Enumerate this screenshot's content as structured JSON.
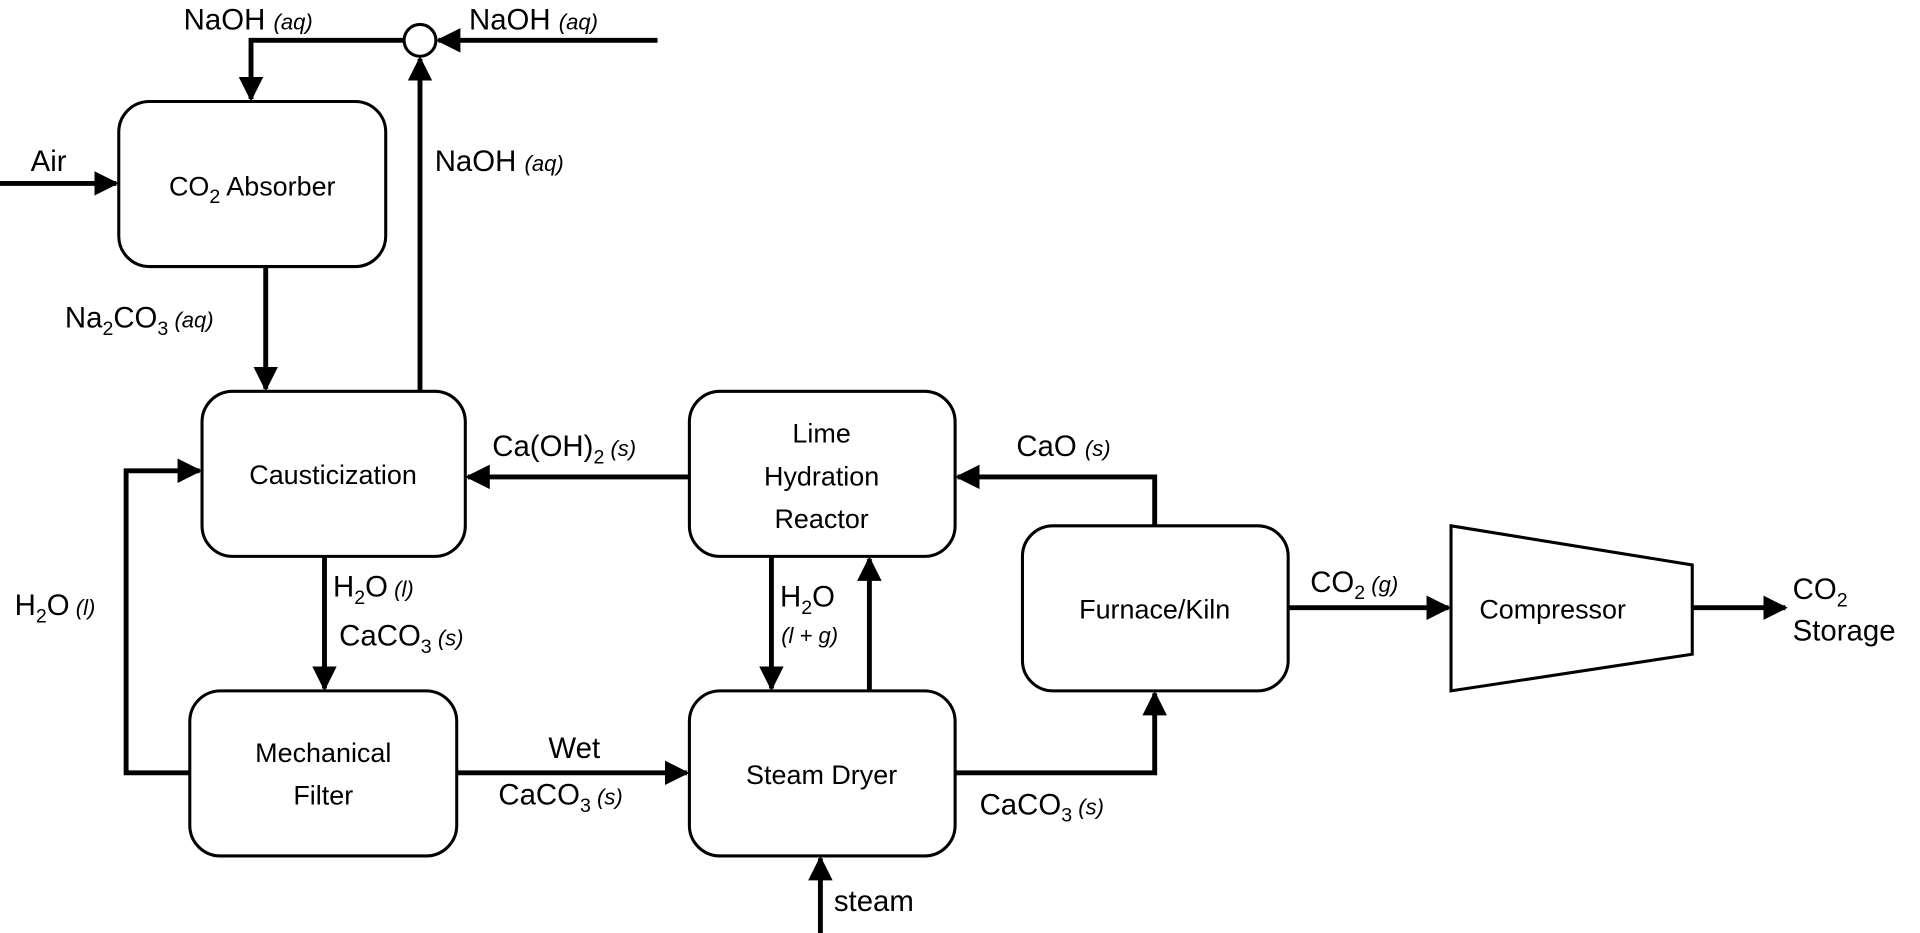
{
  "units": {
    "absorber": {
      "main": "CO",
      "sub": "2",
      "rest": " Absorber"
    },
    "causticization": "Causticization",
    "lime_hydration": [
      "Lime",
      "Hydration",
      "Reactor"
    ],
    "mechanical_filter": [
      "Mechanical",
      "Filter"
    ],
    "steam_dryer": "Steam Dryer",
    "furnace": "Furnace/Kiln",
    "compressor": "Compressor"
  },
  "streams": {
    "naoh_top_left": {
      "formula": "NaOH",
      "phase": "(aq)"
    },
    "naoh_makeup": {
      "formula": "NaOH",
      "phase": "(aq)"
    },
    "naoh_recycle": {
      "formula": "NaOH",
      "phase": "(aq)"
    },
    "air": "Air",
    "na2co3": {
      "a": "Na",
      "s1": "2",
      "b": "CO",
      "s2": "3",
      "phase": "(aq)"
    },
    "caoh2": {
      "a": "Ca(OH)",
      "s1": "2",
      "phase": "(s)"
    },
    "cao": {
      "formula": "CaO",
      "phase": "(s)"
    },
    "h2o_caust": {
      "a": "H",
      "s1": "2",
      "b": "O",
      "phase": "(l)"
    },
    "caco3_caust": {
      "a": "CaCO",
      "s1": "3",
      "phase": "(s)"
    },
    "h2o_recycle": {
      "a": "H",
      "s1": "2",
      "b": "O",
      "phase": "(l)"
    },
    "wet_caco3": {
      "line1": "Wet",
      "a": "CaCO",
      "s1": "3",
      "phase": "(s)"
    },
    "h2o_lime": {
      "a": "H",
      "s1": "2",
      "b": "O",
      "phase": "(l + g)"
    },
    "caco3_dryer": {
      "a": "CaCO",
      "s1": "3",
      "phase": "(s)"
    },
    "steam": "steam",
    "co2_gas": {
      "a": "CO",
      "s1": "2",
      "phase": "(g)"
    },
    "co2_storage": {
      "a": "CO",
      "s1": "2",
      "line2": "Storage"
    }
  }
}
